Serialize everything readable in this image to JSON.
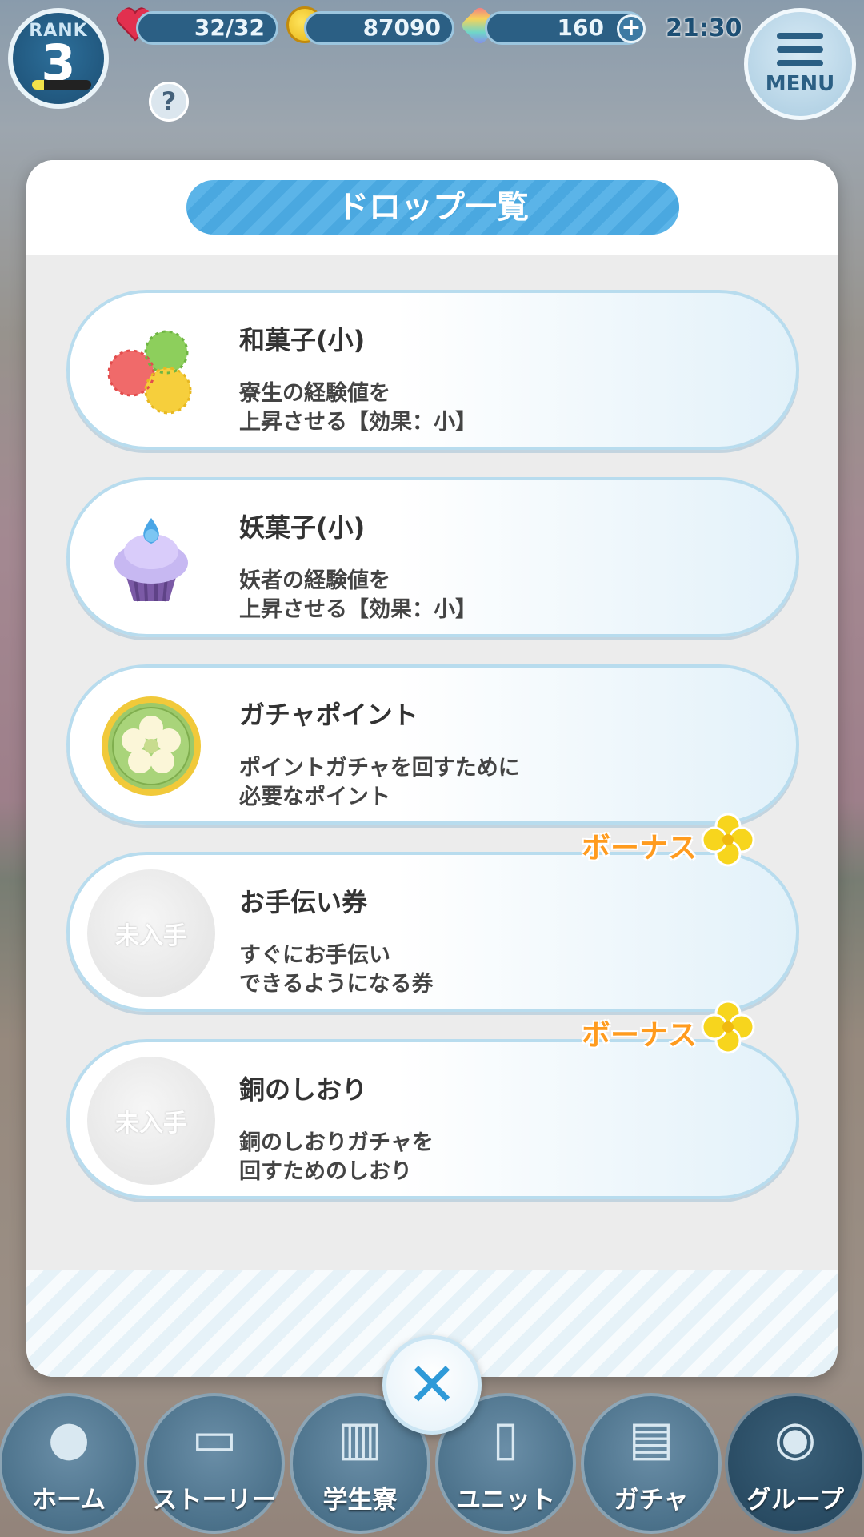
{
  "status_bar": {
    "rank_label": "RANK",
    "rank_value": "3",
    "stamina": "32/32",
    "coins": "87090",
    "gems": "160",
    "plus_symbol": "+",
    "clock": "21:30",
    "menu_label": "MENU",
    "help_symbol": "?"
  },
  "modal": {
    "title": "ドロップ一覧",
    "bonus_label": "ボーナス",
    "unobtained_label": "未入手",
    "items": [
      {
        "name": "和菓子(小)",
        "desc_line1": "寮生の経験値を",
        "desc_line2": "上昇させる【効果：小】",
        "icon": "wagashi-icon"
      },
      {
        "name": "妖菓子(小)",
        "desc_line1": "妖者の経験値を",
        "desc_line2": "上昇させる【効果：小】",
        "icon": "cupcake-icon"
      },
      {
        "name": "ガチャポイント",
        "desc_line1": "ポイントガチャを回すために",
        "desc_line2": "必要なポイント",
        "icon": "gacha-point-coin-icon"
      },
      {
        "name": "お手伝い券",
        "desc_line1": "すぐにお手伝い",
        "desc_line2": "できるようになる券",
        "icon": "unobtained-icon"
      },
      {
        "name": "銅のしおり",
        "desc_line1": "銅のしおりガチャを",
        "desc_line2": "回すためのしおり",
        "icon": "unobtained-icon"
      }
    ],
    "close_symbol": "✕"
  },
  "bottom_nav": [
    {
      "label": "ホーム",
      "icon": "bird-icon"
    },
    {
      "label": "ストーリー",
      "icon": "book-icon"
    },
    {
      "label": "学生寮",
      "icon": "dormitory-icon"
    },
    {
      "label": "ユニット",
      "icon": "cards-icon"
    },
    {
      "label": "ガチャ",
      "icon": "shelf-icon"
    },
    {
      "label": "グループ",
      "icon": "group-icon"
    }
  ],
  "colors": {
    "accent": "#4aa8e0",
    "bonus": "#ff9b1e",
    "card_border": "#b8dcee"
  }
}
